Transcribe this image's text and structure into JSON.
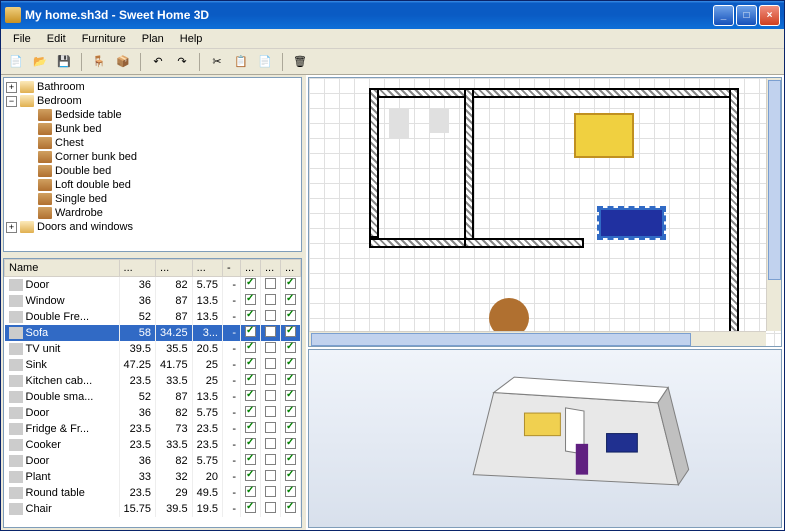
{
  "title": "My home.sh3d - Sweet Home 3D",
  "menu": [
    "File",
    "Edit",
    "Furniture",
    "Plan",
    "Help"
  ],
  "tree": {
    "root1": "Bathroom",
    "root2": "Bedroom",
    "items": [
      "Bedside table",
      "Bunk bed",
      "Chest",
      "Corner bunk bed",
      "Double bed",
      "Loft double bed",
      "Single bed",
      "Wardrobe"
    ],
    "root3": "Doors and windows"
  },
  "table": {
    "header": "Name",
    "rows": [
      {
        "name": "Door",
        "c1": "36",
        "c2": "82",
        "c3": "5.75",
        "sel": false
      },
      {
        "name": "Window",
        "c1": "36",
        "c2": "87",
        "c3": "13.5",
        "sel": false
      },
      {
        "name": "Double Fre...",
        "c1": "52",
        "c2": "87",
        "c3": "13.5",
        "sel": false
      },
      {
        "name": "Sofa",
        "c1": "58",
        "c2": "34.25",
        "c3": "3...",
        "sel": true
      },
      {
        "name": "TV unit",
        "c1": "39.5",
        "c2": "35.5",
        "c3": "20.5",
        "sel": false
      },
      {
        "name": "Sink",
        "c1": "47.25",
        "c2": "41.75",
        "c3": "25",
        "sel": false
      },
      {
        "name": "Kitchen cab...",
        "c1": "23.5",
        "c2": "33.5",
        "c3": "25",
        "sel": false
      },
      {
        "name": "Double sma...",
        "c1": "52",
        "c2": "87",
        "c3": "13.5",
        "sel": false
      },
      {
        "name": "Door",
        "c1": "36",
        "c2": "82",
        "c3": "5.75",
        "sel": false
      },
      {
        "name": "Fridge & Fr...",
        "c1": "23.5",
        "c2": "73",
        "c3": "23.5",
        "sel": false
      },
      {
        "name": "Cooker",
        "c1": "23.5",
        "c2": "33.5",
        "c3": "23.5",
        "sel": false
      },
      {
        "name": "Door",
        "c1": "36",
        "c2": "82",
        "c3": "5.75",
        "sel": false
      },
      {
        "name": "Plant",
        "c1": "33",
        "c2": "32",
        "c3": "20",
        "sel": false
      },
      {
        "name": "Round table",
        "c1": "23.5",
        "c2": "29",
        "c3": "49.5",
        "sel": false
      },
      {
        "name": "Chair",
        "c1": "15.75",
        "c2": "39.5",
        "c3": "19.5",
        "sel": false
      }
    ]
  }
}
